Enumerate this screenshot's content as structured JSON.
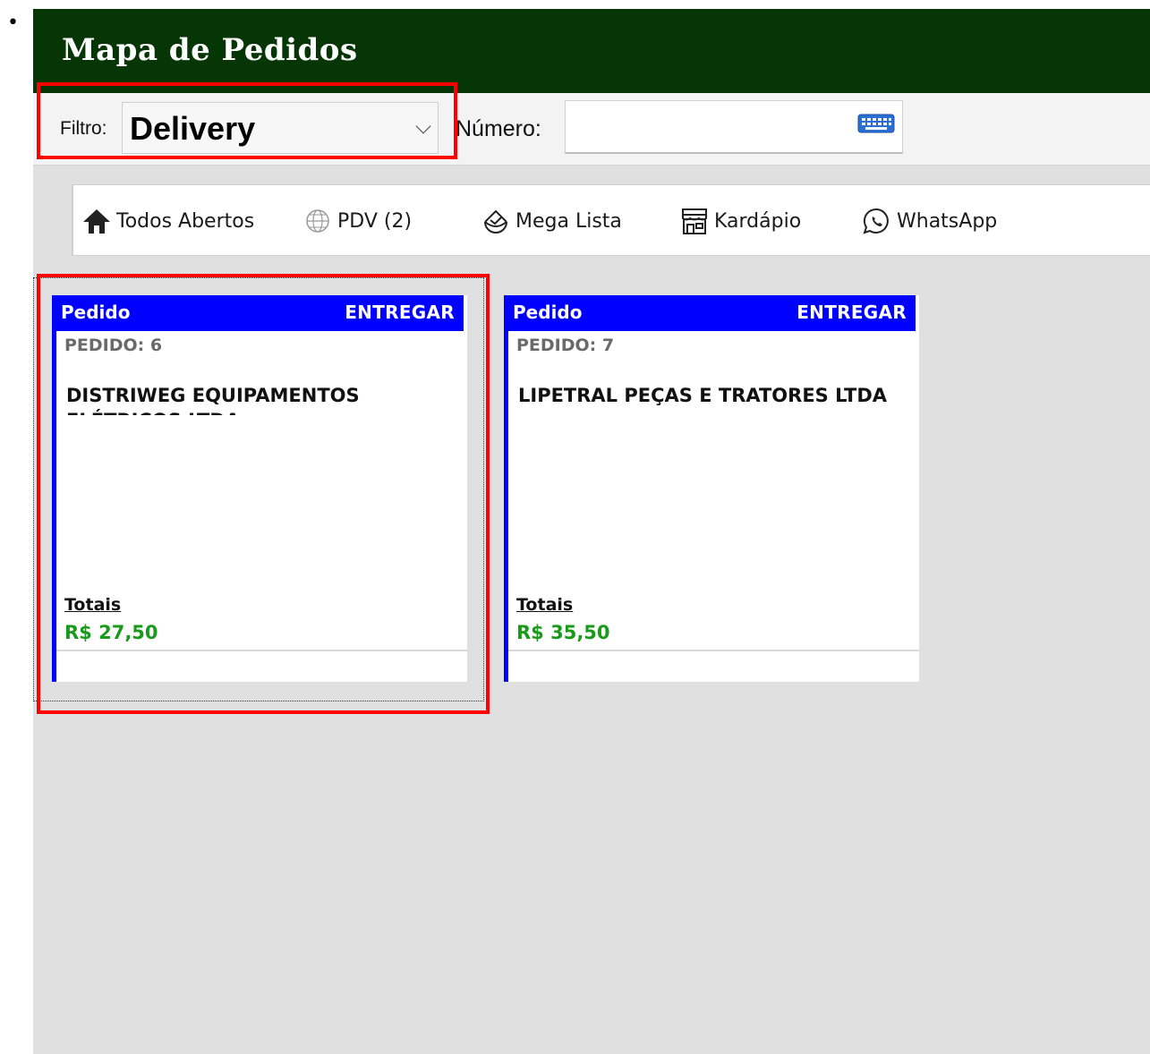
{
  "bullet": "•",
  "window": {
    "title": "Mapa de Pedidos"
  },
  "filter_bar": {
    "filter_label": "Filtro:",
    "filter_value": "Delivery",
    "numero_label": "Número:",
    "numero_value": "",
    "keyboard_icon": "keyboard-icon"
  },
  "nav": {
    "items": [
      {
        "label": "Todos Abertos",
        "icon": "home-icon"
      },
      {
        "label": "PDV (2)",
        "icon": "globe-icon"
      },
      {
        "label": "Mega Lista",
        "icon": "mega-list-icon"
      },
      {
        "label": "Kardápio",
        "icon": "storefront-icon"
      },
      {
        "label": "WhatsApp",
        "icon": "whatsapp-icon"
      }
    ]
  },
  "orders": [
    {
      "header_left": "Pedido",
      "header_right": "ENTREGAR",
      "pedido": "PEDIDO: 6",
      "cliente": "DISTRIWEG EQUIPAMENTOS ELÉTRICOS LTDA",
      "totais_label": "Totais",
      "valor": "R$ 27,50"
    },
    {
      "header_left": "Pedido",
      "header_right": "ENTREGAR",
      "pedido": "PEDIDO: 7",
      "cliente": "LIPETRAL PEÇAS E TRATORES LTDA",
      "totais_label": "Totais",
      "valor": "R$ 35,50"
    }
  ],
  "colors": {
    "title_bar": "#063606",
    "card_accent": "#0000ff",
    "total_value": "#1a9a1a",
    "highlight": "#ff0000"
  }
}
